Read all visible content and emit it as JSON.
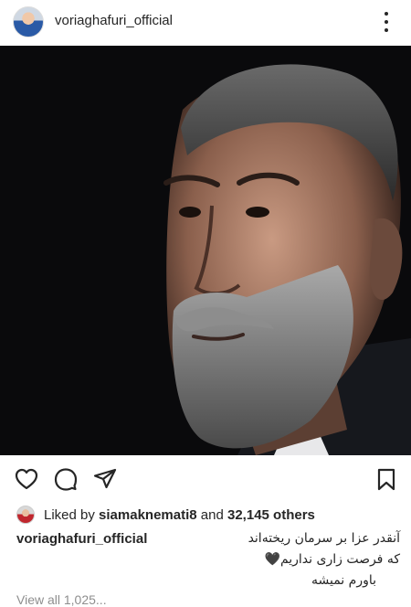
{
  "post": {
    "username": "voriaghafuri_official",
    "likes": {
      "prefix": "Liked by",
      "liker": "siamaknemati8",
      "and": "and",
      "count": "32,145 others"
    },
    "caption": {
      "username": "voriaghafuri_official",
      "line1": "آنقدر عزا بر سرمان ریخته‌اند",
      "line2": "که فرصت زاری نداریم🖤",
      "line3": "باورم نمیشه"
    },
    "comments_partial": "View all 1,025..."
  },
  "icons": {
    "avatar": "profile-photo",
    "more": "more-options-icon",
    "like": "heart-icon",
    "comment": "comment-icon",
    "share": "paper-plane-icon",
    "save": "bookmark-icon"
  },
  "colors": {
    "text": "#262626",
    "secondary": "#8e8e8e",
    "background": "#ffffff",
    "photo_bg": "#0a0a0c"
  }
}
